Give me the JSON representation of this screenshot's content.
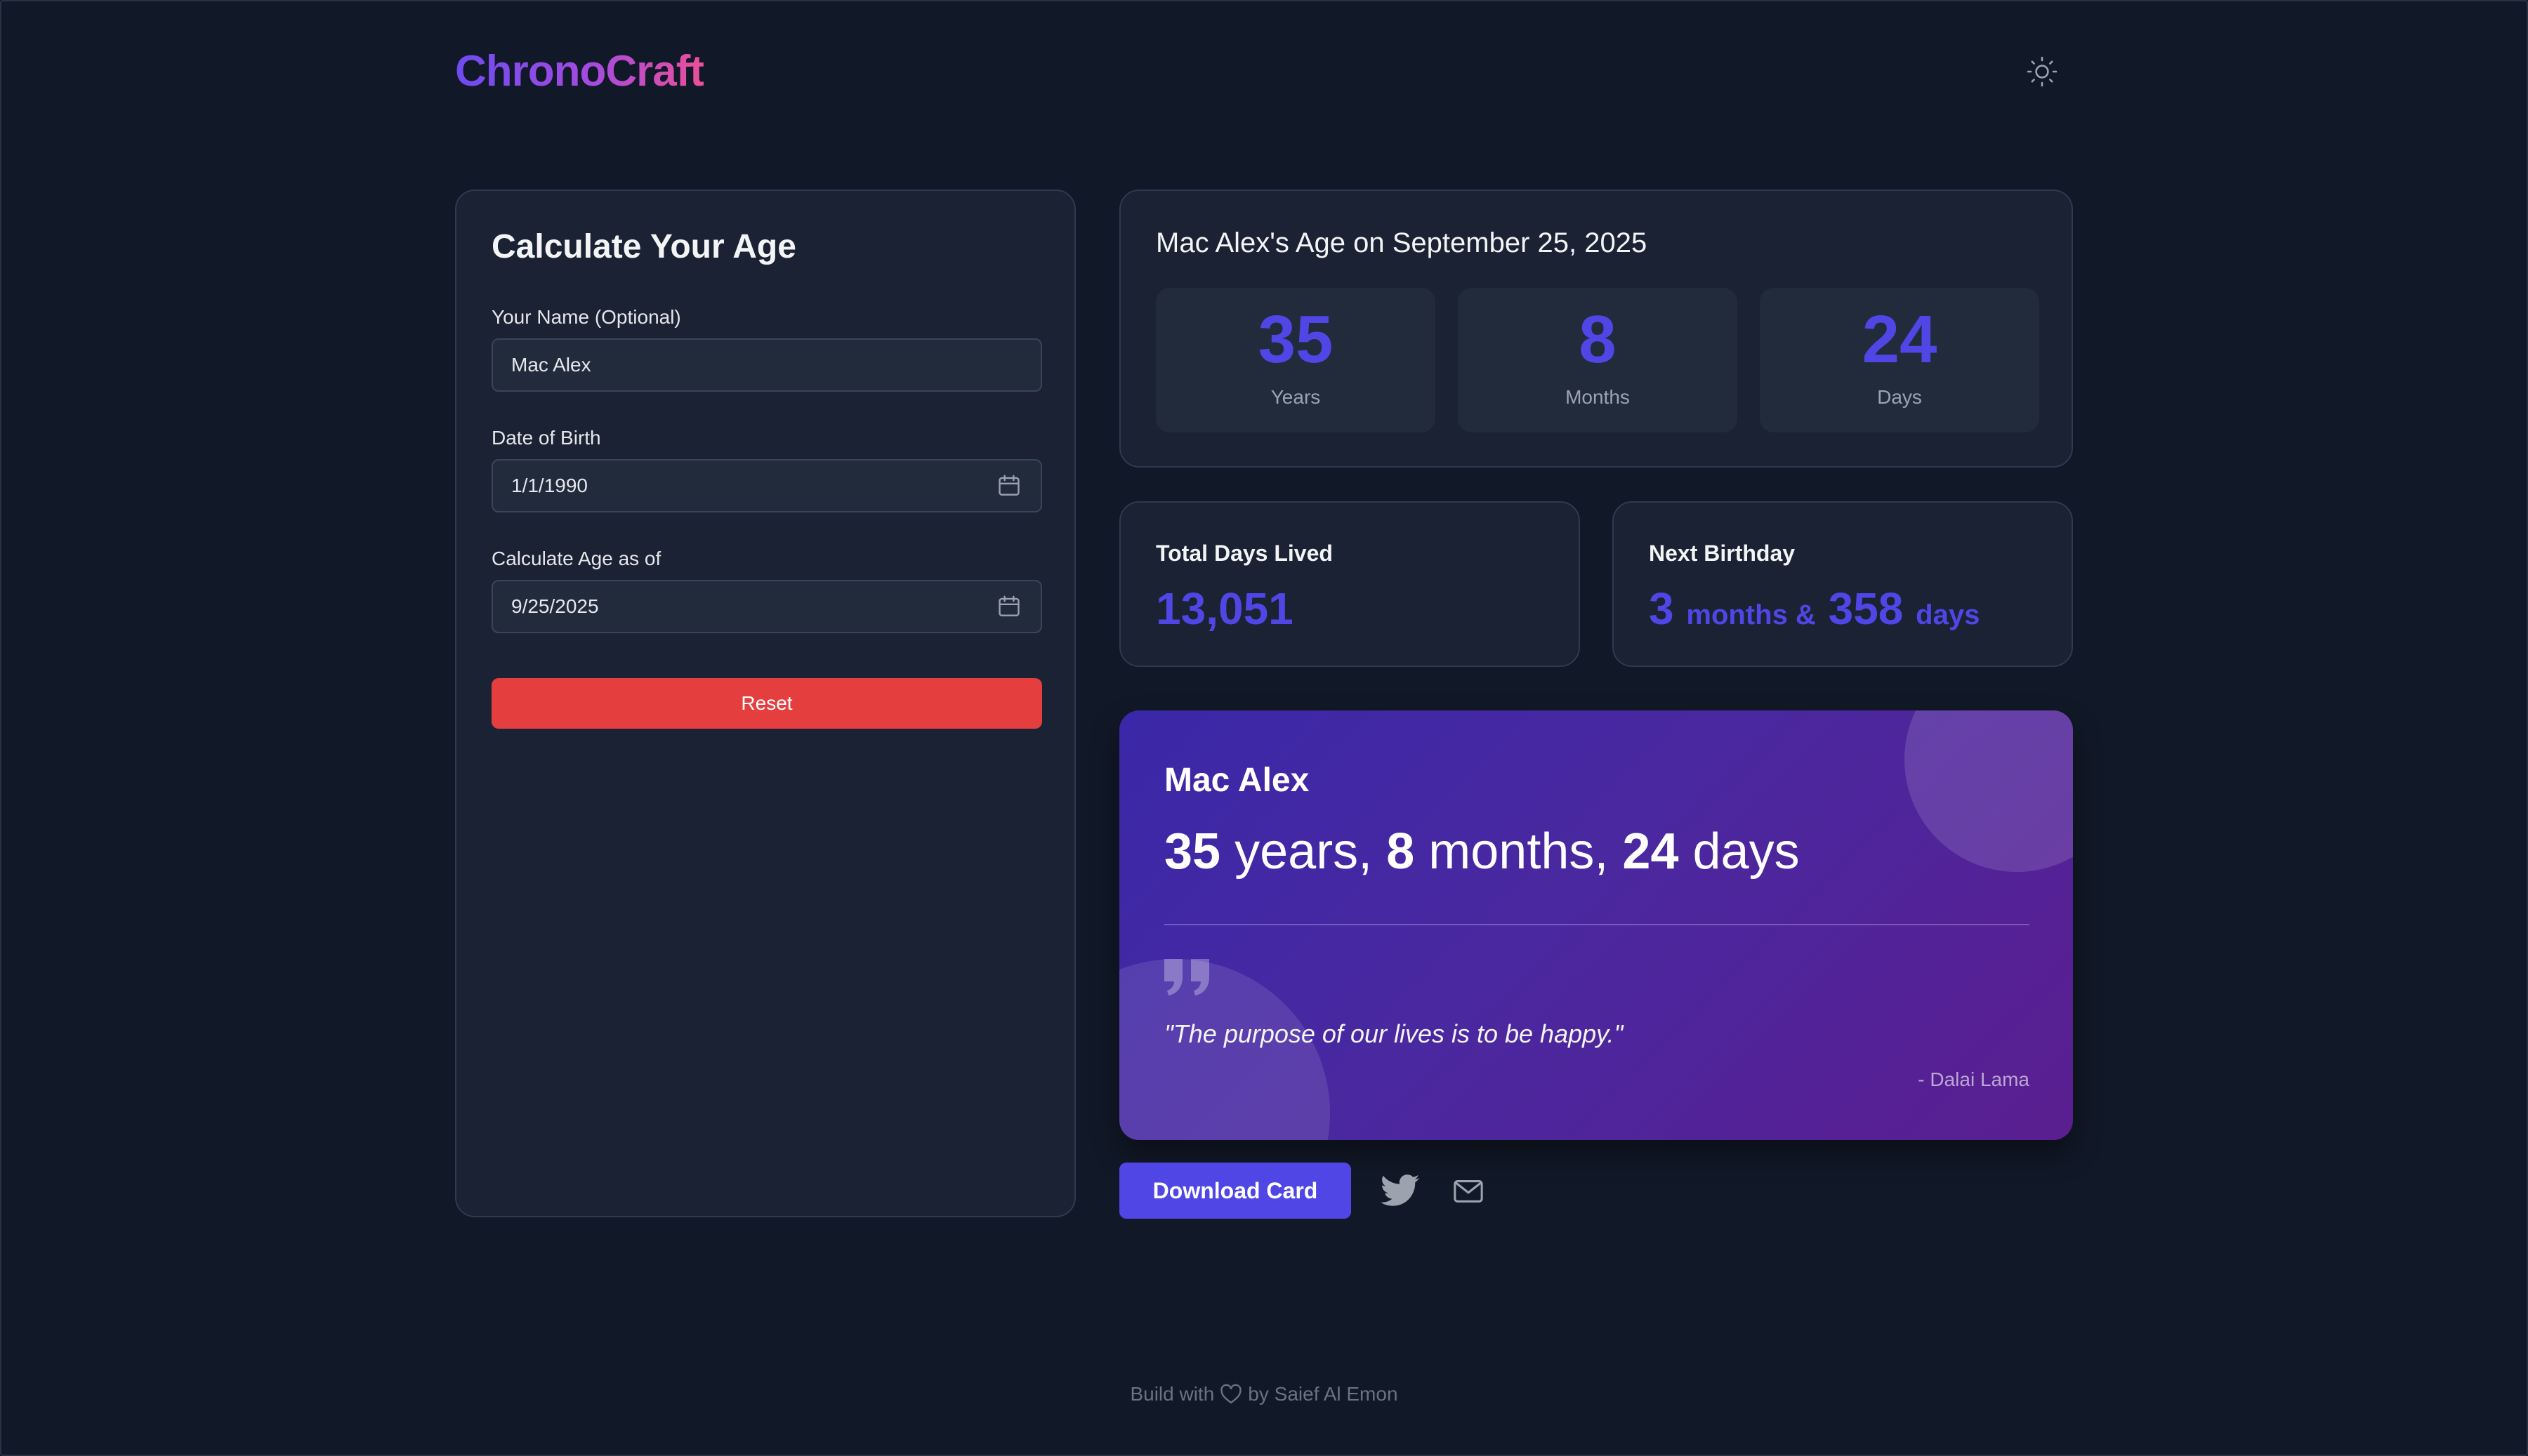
{
  "app": {
    "logo": "ChronoCraft"
  },
  "form": {
    "title": "Calculate Your Age",
    "name_label": "Your Name (Optional)",
    "name_value": "Mac Alex",
    "dob_label": "Date of Birth",
    "dob_value": "1/1/1990",
    "asof_label": "Calculate Age as of",
    "asof_value": "9/25/2025",
    "reset_label": "Reset"
  },
  "age": {
    "title": "Mac Alex's Age on September 25, 2025",
    "years": "35",
    "years_label": "Years",
    "months": "8",
    "months_label": "Months",
    "days": "24",
    "days_label": "Days"
  },
  "total_days": {
    "title": "Total Days Lived",
    "value": "13,051"
  },
  "next_birthday": {
    "title": "Next Birthday",
    "months": "3",
    "months_unit": "months &",
    "days": "358",
    "days_unit": "days"
  },
  "share_card": {
    "name": "Mac Alex",
    "years": "35",
    "years_unit": "years,",
    "months": "8",
    "months_unit": "months,",
    "days": "24",
    "days_unit": "days",
    "quote": "\"The purpose of our lives is to be happy.\"",
    "author": "- Dalai Lama"
  },
  "actions": {
    "download_label": "Download Card"
  },
  "footer": {
    "prefix": "Build with",
    "suffix": "by Saief Al Emon"
  },
  "colors": {
    "background": "#111827",
    "card": "#1a2233",
    "accent": "#4f46e5",
    "reset": "#e53e3e"
  },
  "icons": [
    "sun-icon",
    "calendar-icon",
    "quote-icon",
    "twitter-icon",
    "mail-icon",
    "heart-icon"
  ]
}
